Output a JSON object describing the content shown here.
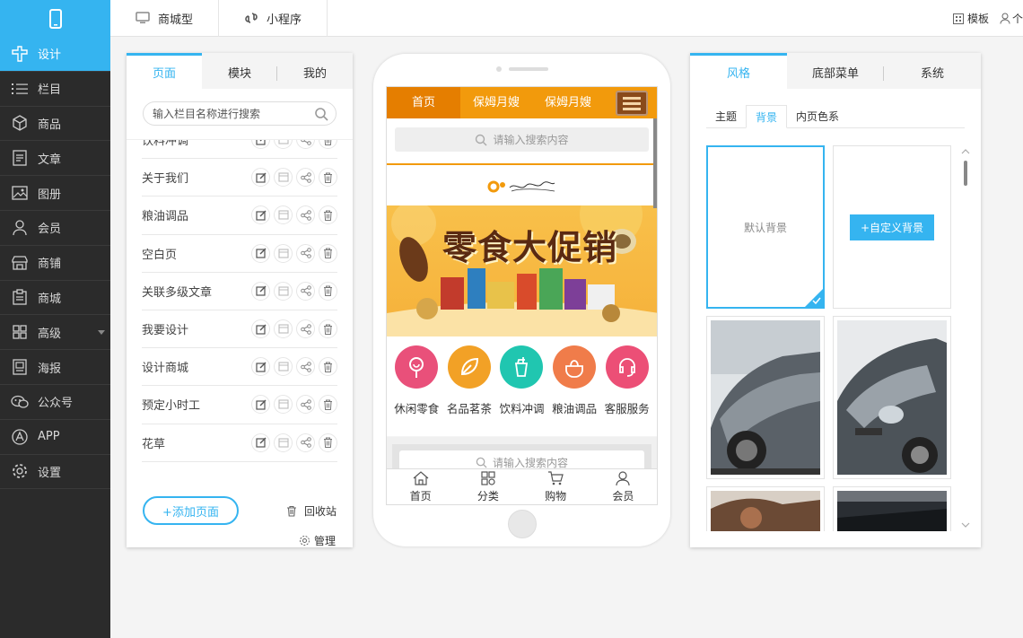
{
  "nav": {
    "items": [
      {
        "label": "设计",
        "icon": "design-icon",
        "active": true
      },
      {
        "label": "栏目",
        "icon": "list-icon"
      },
      {
        "label": "商品",
        "icon": "box-icon"
      },
      {
        "label": "文章",
        "icon": "article-icon"
      },
      {
        "label": "图册",
        "icon": "image-icon"
      },
      {
        "label": "会员",
        "icon": "user-icon"
      },
      {
        "label": "商铺",
        "icon": "store-icon"
      },
      {
        "label": "商城",
        "icon": "clipboard-icon"
      },
      {
        "label": "高级",
        "icon": "grid-icon"
      },
      {
        "label": "海报",
        "icon": "poster-icon"
      },
      {
        "label": "公众号",
        "icon": "wechat-icon"
      },
      {
        "label": "APP",
        "icon": "app-icon"
      },
      {
        "label": "设置",
        "icon": "settings-icon"
      }
    ]
  },
  "topbar": {
    "tab1": "商城型",
    "tab2": "小程序",
    "template": "模板",
    "user": "个"
  },
  "left_panel": {
    "tabs": [
      "页面",
      "模块",
      "我的"
    ],
    "search_placeholder": "输入栏目名称进行搜索",
    "pages": [
      "饮料冲调",
      "关于我们",
      "粮油调品",
      "空白页",
      "关联多级文章",
      "我要设计",
      "设计商城",
      "预定小时工",
      "花草"
    ],
    "add_page": "+添加页面",
    "recycle": "回收站",
    "manage": "管理"
  },
  "phone": {
    "nav": [
      "首页",
      "保姆月嫂",
      "保姆月嫂"
    ],
    "search_placeholder": "请输入搜索内容",
    "banner_text": "零食大促销",
    "icons": [
      {
        "label": "休闲零食",
        "color": "#e9507a"
      },
      {
        "label": "名品茗茶",
        "color": "#f2a126"
      },
      {
        "label": "饮料冲调",
        "color": "#20c6b0"
      },
      {
        "label": "粮油调品",
        "color": "#f07c4a"
      },
      {
        "label": "客服服务",
        "color": "#ec4f76"
      }
    ],
    "search2_placeholder": "请输入搜索内容",
    "bottom": [
      "首页",
      "分类",
      "购物",
      "会员"
    ]
  },
  "right_panel": {
    "tabs": [
      "风格",
      "底部菜单",
      "系统"
    ],
    "subtabs": [
      "主题",
      "背景",
      "内页色系"
    ],
    "default_bg": "默认背景",
    "custom_bg": "+自定义背景"
  },
  "colors": {
    "accent": "#35b4f0",
    "sidebar": "#2b2b2b",
    "phone_nav": "#f29a0c"
  }
}
